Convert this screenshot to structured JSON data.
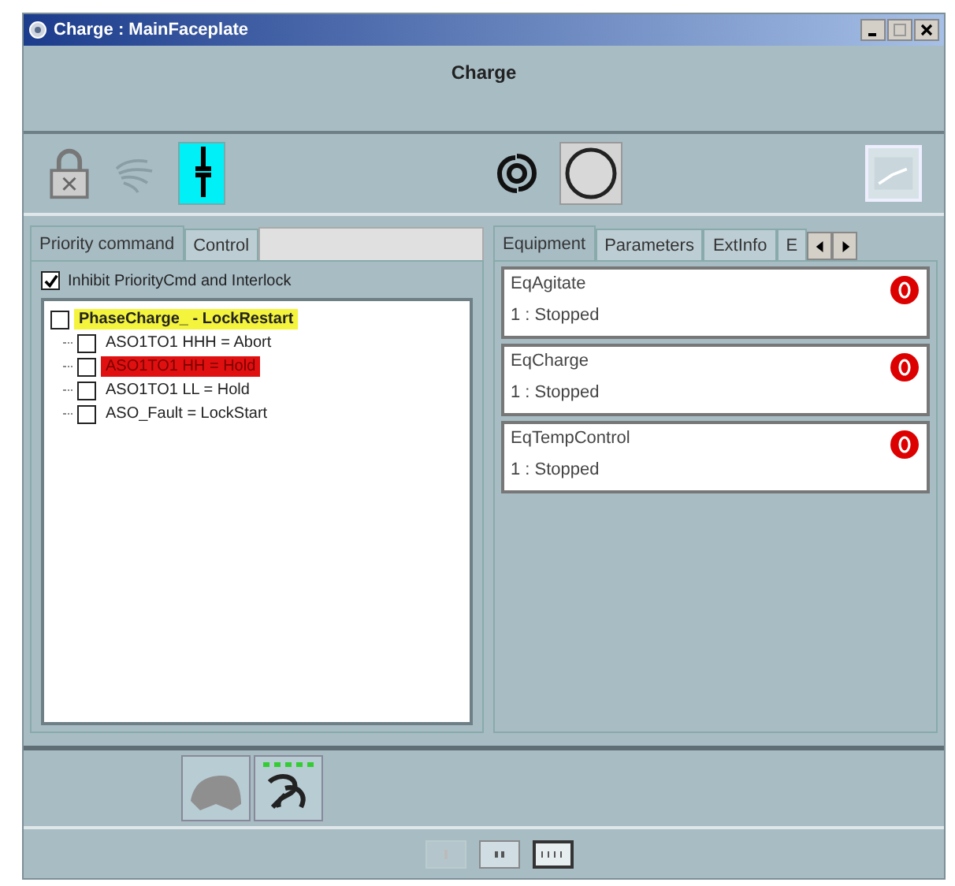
{
  "window": {
    "title": "Charge : MainFaceplate"
  },
  "header": {
    "title": "Charge"
  },
  "left_tabs": [
    {
      "label": "Priority command",
      "selected": true
    },
    {
      "label": "Control",
      "selected": false
    }
  ],
  "inhibit": {
    "label": "Inhibit PriorityCmd and Interlock",
    "checked": true
  },
  "tree": [
    {
      "label": "PhaseCharge_ - LockRestart",
      "checked": false,
      "color": "#f4f43c",
      "children": [
        {
          "label": "ASO1TO1 HHH = Abort",
          "checked": false
        },
        {
          "label": "ASO1TO1 HH = Hold",
          "checked": false,
          "color": "#e01010"
        },
        {
          "label": "ASO1TO1 LL = Hold",
          "checked": false
        },
        {
          "label": "ASO_Fault = LockStart",
          "checked": false
        }
      ]
    }
  ],
  "right_tabs": [
    {
      "label": "Equipment",
      "selected": true
    },
    {
      "label": "Parameters",
      "selected": false
    },
    {
      "label": "ExtInfo",
      "selected": false
    },
    {
      "label": "E",
      "selected": false
    }
  ],
  "equipment": [
    {
      "name": "EqAgitate",
      "state": "1 : Stopped"
    },
    {
      "name": "EqCharge",
      "state": "1 : Stopped"
    },
    {
      "name": "EqTempControl",
      "state": "1 : Stopped"
    }
  ]
}
